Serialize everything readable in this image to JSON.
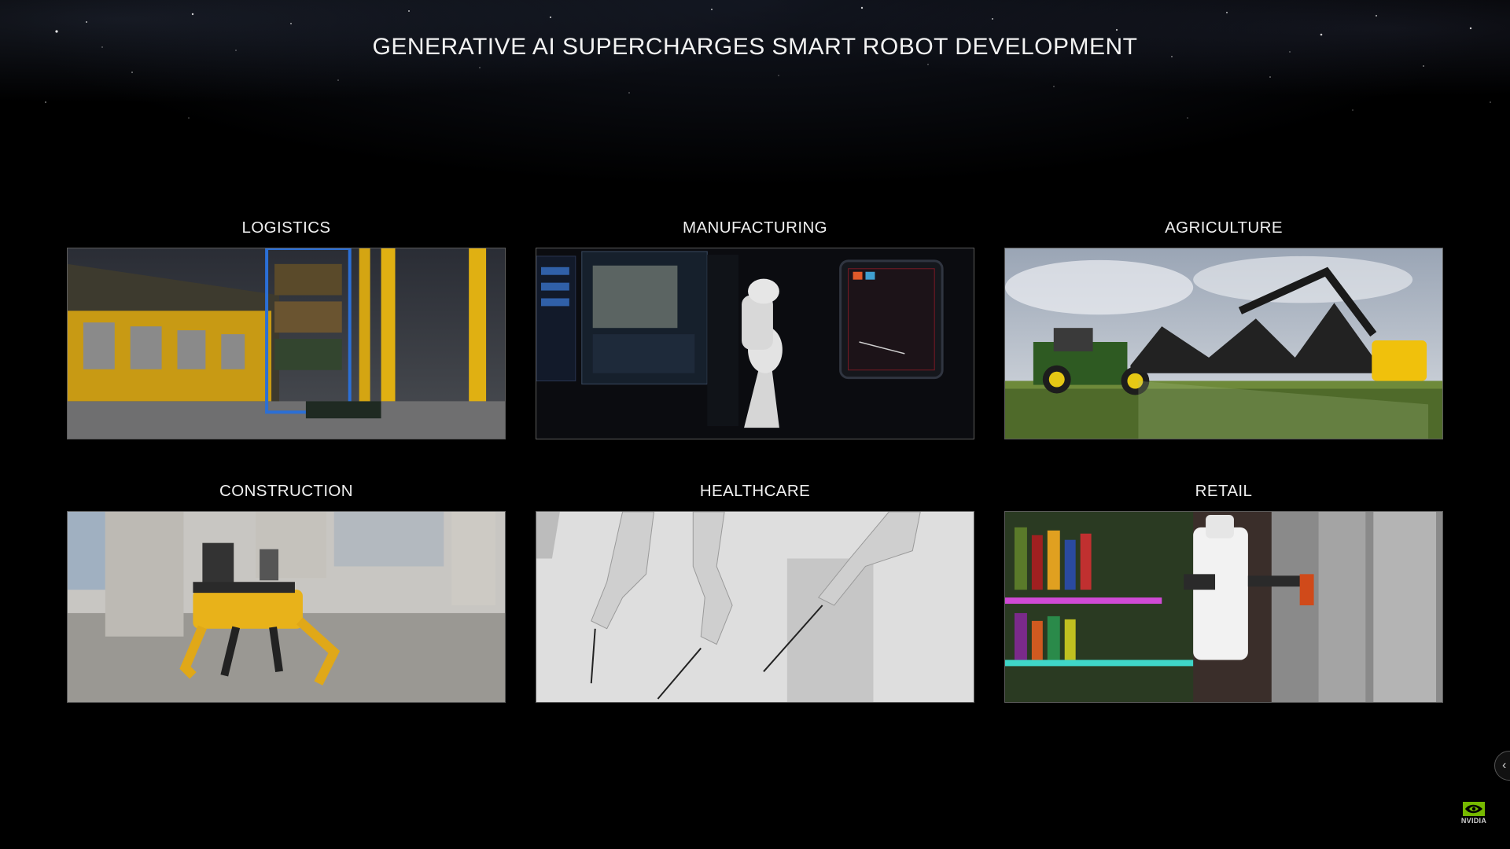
{
  "slide": {
    "title": "GENERATIVE AI SUPERCHARGES SMART ROBOT DEVELOPMENT"
  },
  "cards": [
    {
      "label": "LOGISTICS",
      "image_icon": "warehouse-robot-image"
    },
    {
      "label": "MANUFACTURING",
      "image_icon": "robot-arm-image"
    },
    {
      "label": "AGRICULTURE",
      "image_icon": "crop-sprayer-image"
    },
    {
      "label": "CONSTRUCTION",
      "image_icon": "quadruped-robot-image"
    },
    {
      "label": "HEALTHCARE",
      "image_icon": "surgical-robot-image"
    },
    {
      "label": "RETAIL",
      "image_icon": "retail-robot-image"
    }
  ],
  "brand": {
    "logo_text": "NVIDIA",
    "accent": "#76b900"
  },
  "nav": {
    "icon": "chevron-left-icon"
  }
}
